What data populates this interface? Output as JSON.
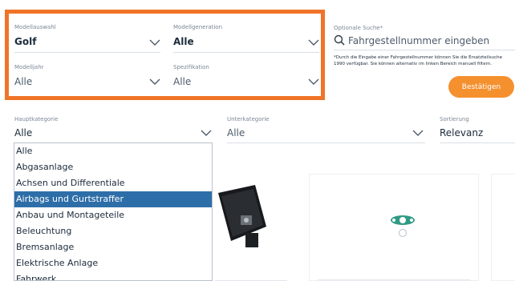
{
  "filters": {
    "model": {
      "label": "Modellauswahl",
      "value": "Golf"
    },
    "generation": {
      "label": "Modellgeneration",
      "value": "Alle"
    },
    "year": {
      "label": "Modelljahr",
      "value": "Alle"
    },
    "spec": {
      "label": "Spezifikation",
      "value": "Alle"
    }
  },
  "search": {
    "label": "Optionale Suche*",
    "placeholder": "Fahrgestellnummer eingeben",
    "note_line1": "*Durch die Eingabe einer Fahrgestellnummer können Sie die Ersatzteilsuche",
    "note_line2": "1990 verfügbar. Sie können alternativ im linken Bereich manuell filtern.",
    "button": "Bestätigen"
  },
  "category": {
    "label": "Hauptkategorie",
    "value": "Alle"
  },
  "subcategory": {
    "label": "Unterkategorie",
    "value": "Alle"
  },
  "sort": {
    "label": "Sortierung",
    "value": "Relevanz"
  },
  "dropdown": {
    "options": [
      "Alle",
      "Abgasanlage",
      "Achsen und Differentiale",
      "Airbags und Gurtstraffer",
      "Anbau und Montageteile",
      "Beleuchtung",
      "Bremsanlage",
      "Elektrische Anlage",
      "Fahrwerk"
    ],
    "selected_index": 3
  },
  "colors": {
    "accent": "#f07428",
    "button": "#f5902f",
    "selected": "#2e6ea8"
  }
}
